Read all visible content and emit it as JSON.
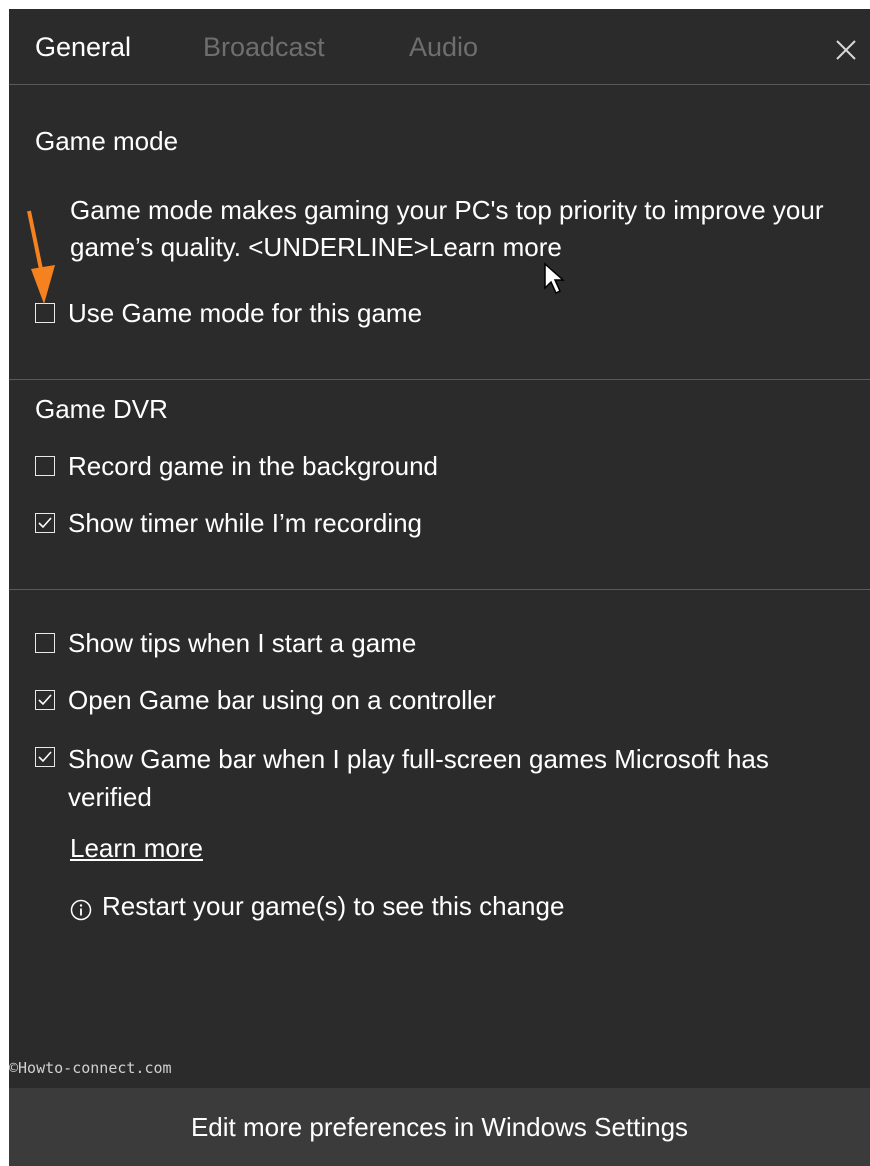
{
  "tabs": [
    {
      "label": "General",
      "active": true
    },
    {
      "label": "Broadcast",
      "active": false
    },
    {
      "label": "Audio",
      "active": false
    }
  ],
  "close_icon": "close-icon",
  "game_mode": {
    "title": "Game mode",
    "description": "Game mode makes gaming your PC's top priority to improve your game’s quality. <UNDERLINE>Learn more",
    "checkbox": {
      "label": "Use Game mode for this game",
      "checked": false
    }
  },
  "game_dvr": {
    "title": "Game DVR",
    "checkboxes": [
      {
        "label": "Record game in the background",
        "checked": false
      },
      {
        "label": "Show timer while I’m recording",
        "checked": true
      }
    ]
  },
  "general_options": {
    "checkboxes": [
      {
        "label": "Show tips when I start a game",
        "checked": false
      },
      {
        "label": "Open Game bar using  on a controller",
        "checked": true
      },
      {
        "label": "Show Game bar when I play full-screen games Microsoft has verified",
        "checked": true
      }
    ],
    "learn_more": "Learn more",
    "info_text": "Restart your game(s) to see this change"
  },
  "watermark": "©Howto-connect.com",
  "footer": {
    "label": "Edit more preferences in Windows Settings"
  },
  "colors": {
    "background": "#2b2b2b",
    "footer": "#3b3b3b",
    "divider": "#5a5a5a",
    "arrow": "#f5821f",
    "inactive_tab": "#6e6e6e"
  }
}
